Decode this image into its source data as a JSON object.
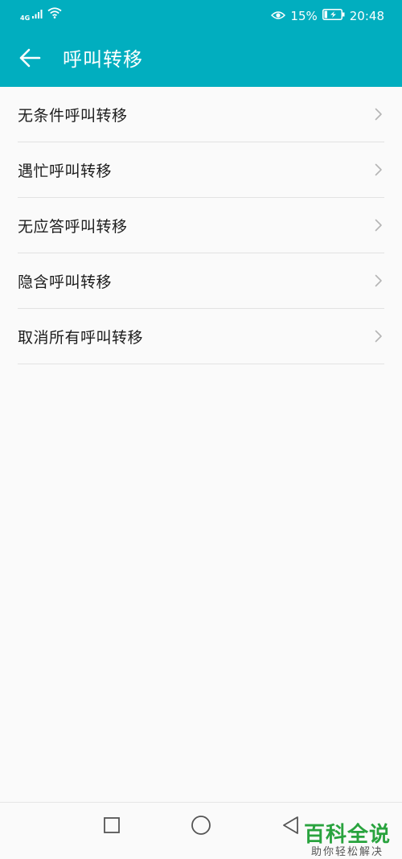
{
  "status_bar": {
    "network_label": "4G",
    "battery_percent": "15%",
    "time": "20:48"
  },
  "app_bar": {
    "title": "呼叫转移"
  },
  "list": {
    "items": [
      {
        "label": "无条件呼叫转移"
      },
      {
        "label": "遇忙呼叫转移"
      },
      {
        "label": "无应答呼叫转移"
      },
      {
        "label": "隐含呼叫转移"
      },
      {
        "label": "取消所有呼叫转移"
      }
    ]
  },
  "watermark": {
    "title": "百科全说",
    "subtitle": "助你轻松解决"
  },
  "colors": {
    "accent": "#01aebf",
    "background": "#fafafa",
    "divider": "#e2e2e2",
    "chevron": "#b5b5b5",
    "watermark": "#29a33e"
  },
  "icons": {
    "back": "arrow-left-icon",
    "chevron": "chevron-right-icon",
    "signal": "signal-icon",
    "wifi": "wifi-icon",
    "eye": "eye-comfort-icon",
    "battery": "battery-charging-icon",
    "recents": "square-icon",
    "home": "circle-icon",
    "nav_back": "triangle-back-icon"
  }
}
